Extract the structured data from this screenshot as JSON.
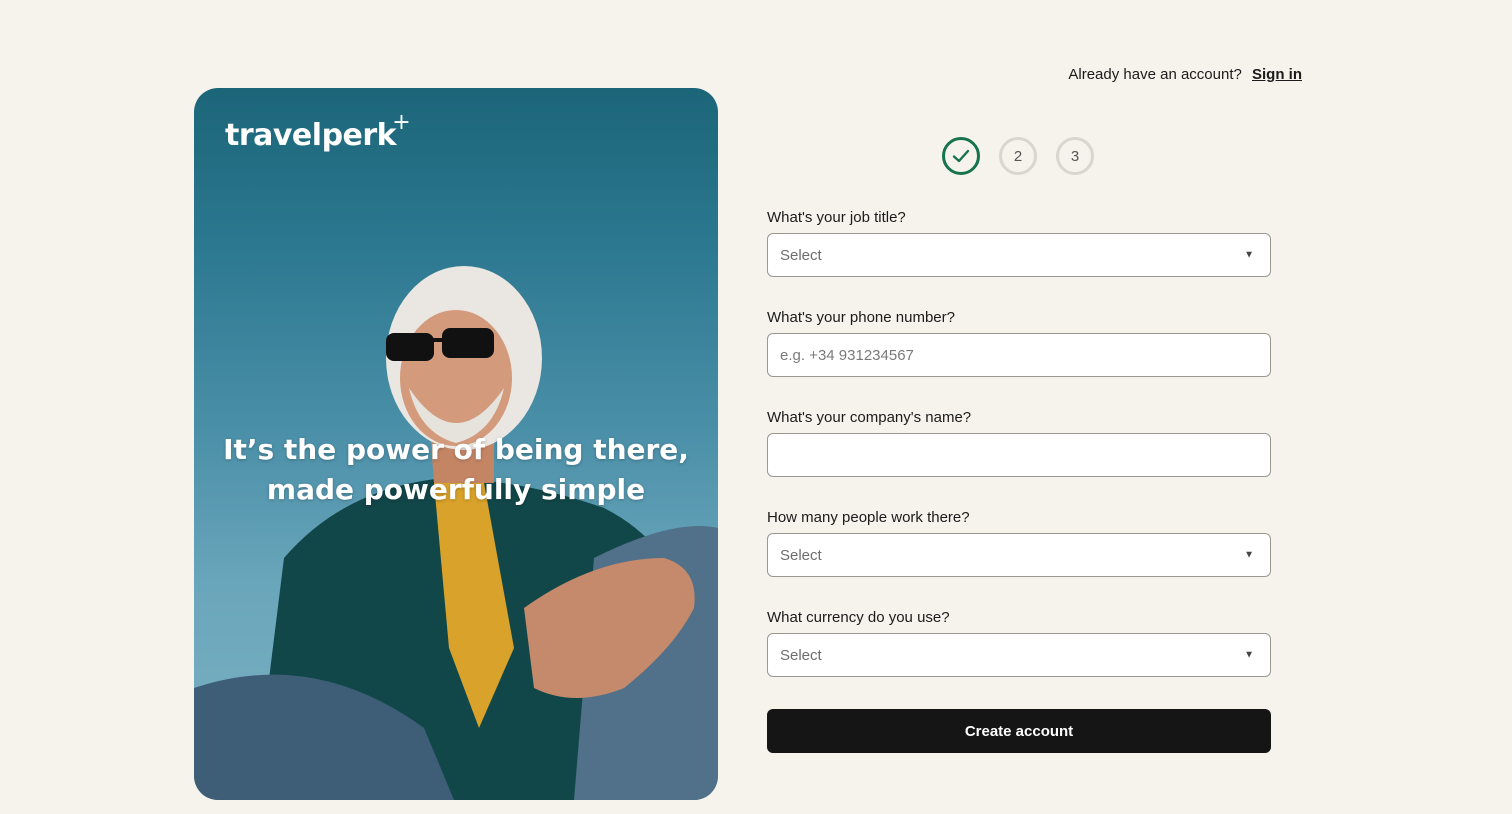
{
  "header": {
    "prompt": "Already have an account?",
    "signin_label": "Sign in"
  },
  "hero": {
    "logo": "travelperk",
    "logo_mark": "+",
    "tagline_line1": "It’s the power of being there,",
    "tagline_line2": "made powerfully simple"
  },
  "stepper": {
    "steps": [
      {
        "label": "",
        "state": "done",
        "icon": "check-icon"
      },
      {
        "label": "2",
        "state": "pending"
      },
      {
        "label": "3",
        "state": "pending"
      }
    ],
    "done_color": "#17744a"
  },
  "form": {
    "job_title": {
      "label": "What's your job title?",
      "value": "Select"
    },
    "phone": {
      "label": "What's your phone number?",
      "placeholder": "e.g. +34 931234567",
      "value": ""
    },
    "company": {
      "label": "What's your company's name?",
      "placeholder": "",
      "value": ""
    },
    "employees": {
      "label": "How many people work there?",
      "value": "Select"
    },
    "currency": {
      "label": "What currency do you use?",
      "value": "Select"
    },
    "submit_label": "Create account"
  }
}
